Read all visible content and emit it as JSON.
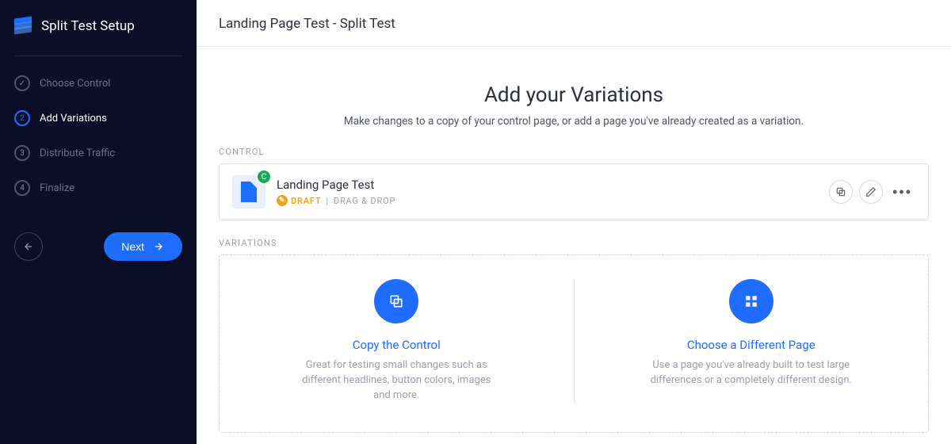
{
  "sidebar": {
    "title": "Split Test Setup",
    "steps": [
      {
        "label": "Choose Control",
        "state": "done"
      },
      {
        "label": "Add Variations",
        "state": "active",
        "num": "2"
      },
      {
        "label": "Distribute Traffic",
        "state": "pending",
        "num": "3"
      },
      {
        "label": "Finalize",
        "state": "pending",
        "num": "4"
      }
    ],
    "next_label": "Next"
  },
  "header": {
    "breadcrumb": "Landing Page Test - Split Test"
  },
  "hero": {
    "title": "Add your Variations",
    "subtitle": "Make changes to a copy of your control page, or add a page you've already created as a variation."
  },
  "sections": {
    "control_label": "CONTROL",
    "variations_label": "VARIATIONS"
  },
  "control": {
    "badge_letter": "C",
    "title": "Landing Page Test",
    "status": "DRAFT",
    "separator": "|",
    "builder": "DRAG & DROP"
  },
  "variation_options": {
    "copy": {
      "title": "Copy the Control",
      "desc": "Great for testing small changes such as different headlines, button colors, images and more."
    },
    "choose": {
      "title": "Choose a Different Page",
      "desc": "Use a page you've already built to test large differences or a completely different design."
    }
  }
}
